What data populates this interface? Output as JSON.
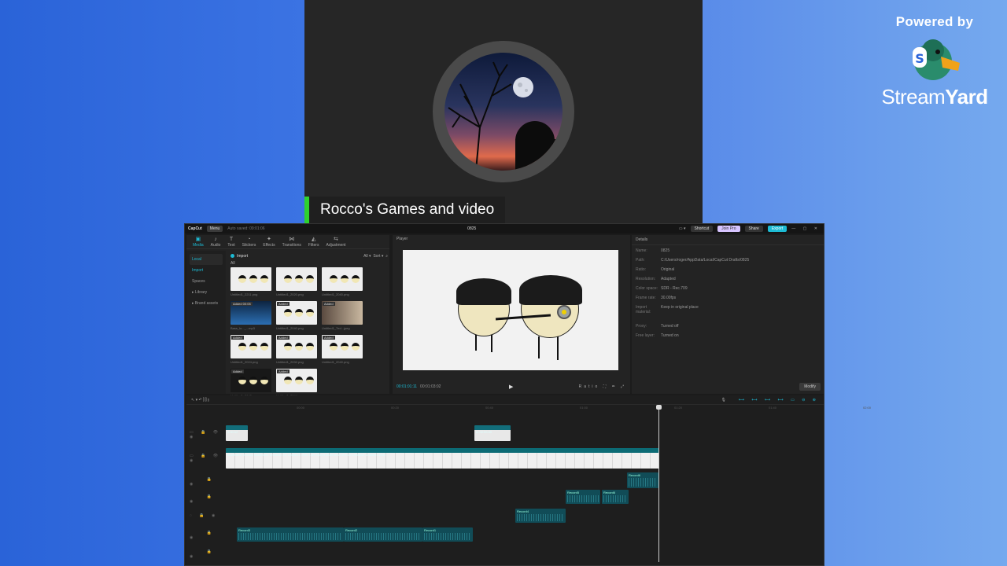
{
  "stream": {
    "name_tag": "Rocco's Games and video",
    "powered_by": "Powered by",
    "brand_stream": "Stream",
    "brand_yard": "Yard"
  },
  "titlebar": {
    "logo": "CapCut",
    "menu": "Menu",
    "autosave": "Auto saved: 09:01:06",
    "project_name": "0825",
    "layout_btn": "▭ ▾",
    "shortcut": "Shortcut",
    "join_pro": "Join Pro",
    "share": "Share",
    "export": "Export",
    "window_controls": "— ▢ ✕"
  },
  "toolbar": {
    "tools": [
      {
        "icon": "▣",
        "label": "Media",
        "active": true
      },
      {
        "icon": "♪",
        "label": "Audio"
      },
      {
        "icon": "T",
        "label": "Text"
      },
      {
        "icon": "◔",
        "label": "Stickers"
      },
      {
        "icon": "✦",
        "label": "Effects"
      },
      {
        "icon": "⋈",
        "label": "Transitions"
      },
      {
        "icon": "◭",
        "label": "Filters"
      },
      {
        "icon": "⇆",
        "label": "Adjustment"
      }
    ]
  },
  "media": {
    "side_items": [
      "Local",
      "Import",
      "Spaces",
      "▸ Library",
      "▸ Brand assets"
    ],
    "import_label": "Import",
    "all_label": "All",
    "sort_label": "Sort ▾",
    "filter_label": "All ▾",
    "thumbs": [
      {
        "cap": "Untitled1_2211.png",
        "badge": "",
        "kind": "light"
      },
      {
        "cap": "Untitled1_2020.png",
        "badge": "",
        "kind": "light"
      },
      {
        "cap": "Untitled1_2040.png",
        "badge": "",
        "kind": "light"
      },
      {
        "cap": "Bass_lo..._...mp3",
        "badge": "Added 00:05",
        "kind": "blue"
      },
      {
        "cap": "Untitled1_2040.png",
        "badge": "Added",
        "kind": "light"
      },
      {
        "cap": "Untitled1_7ed...jpeg",
        "badge": "Added",
        "kind": "brown"
      },
      {
        "cap": "Untitled1_2024.png",
        "badge": "Added",
        "kind": "light"
      },
      {
        "cap": "Untitled1_2032.png",
        "badge": "Added",
        "kind": "light"
      },
      {
        "cap": "Untitled1_2040.png",
        "badge": "Added",
        "kind": "light"
      },
      {
        "cap": "Untitled1_2043.png",
        "badge": "Added",
        "kind": "dark"
      },
      {
        "cap": "Untitled1_2044.png",
        "badge": "Added",
        "kind": "light"
      }
    ]
  },
  "player": {
    "title": "Player",
    "timecode": "00:01:01:11",
    "duration": "00:01:03:02",
    "ratio": "Ratio",
    "right_ctl": "⛶ ▭ ⤢"
  },
  "details": {
    "title": "Details",
    "rows": [
      {
        "k": "Name:",
        "v": "0825"
      },
      {
        "k": "Path:",
        "v": "C:/Users/roger/AppData/Local/CapCut Drafts/0825"
      },
      {
        "k": "Ratio:",
        "v": "Original"
      },
      {
        "k": "Resolution:",
        "v": "Adapted"
      },
      {
        "k": "Color space:",
        "v": "SDR - Rec.709"
      },
      {
        "k": "Frame rate:",
        "v": "30.00fps"
      },
      {
        "k": "Import material:",
        "v": "Keep in original place"
      }
    ],
    "rows2": [
      {
        "k": "Proxy:",
        "v": "Turned off"
      },
      {
        "k": "Free layer:",
        "v": "Turned on"
      }
    ],
    "modify": "Modify"
  },
  "timeline": {
    "tools_left": "↖ ▾  ↶    ⫿  ⫿  ⫾",
    "tools_right": "⟷ ⟷ ⟷ ⟷ ▭ ⊖ ⊕",
    "mic": "🎙",
    "ruler": [
      "00:00",
      "00:20",
      "00:40",
      "01:00",
      "01:20",
      "01:40",
      "02:00"
    ],
    "text_clips": [
      "0:00:12",
      "In 00:00:00"
    ],
    "video_labels": "Multiframe of ecco   Multiframe   Untitled1 2D   Untitled1 2040   1.8x Speed   Multiframe of ecco   Untitled1   Untitled1 2043",
    "record_labels": [
      "Record3",
      "Record2",
      "Record1",
      "Record4",
      "Record5",
      "Record6",
      "Record6"
    ]
  }
}
